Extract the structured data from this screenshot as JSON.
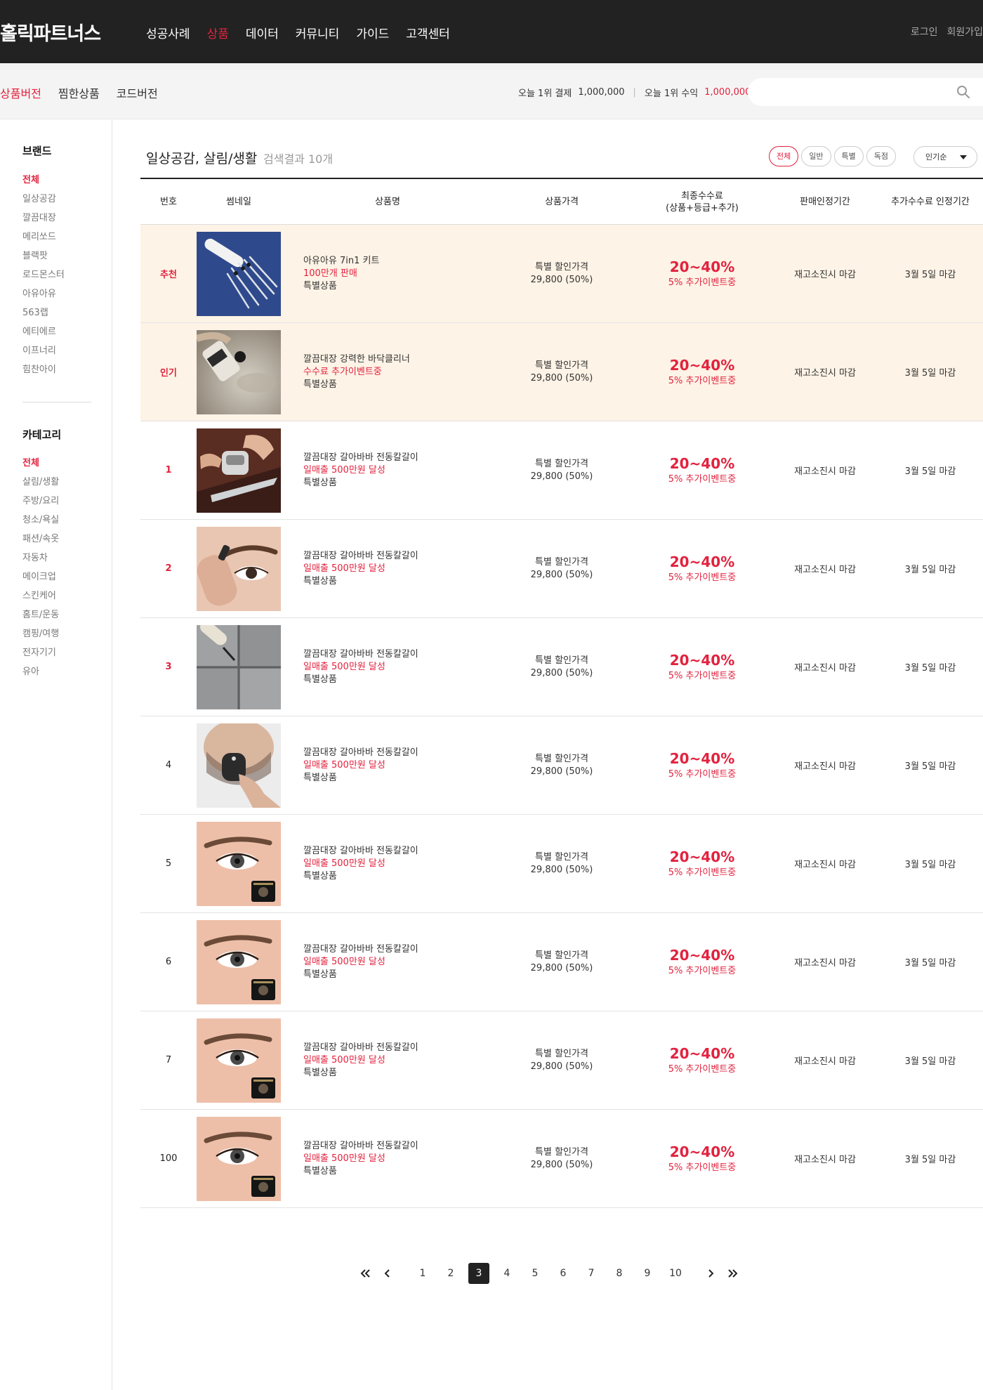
{
  "header": {
    "logo": "홀릭파트너스",
    "nav": [
      "성공사례",
      "상품",
      "데이터",
      "커뮤니티",
      "가이드",
      "고객센터"
    ],
    "nav_active": 1,
    "login": "로그인",
    "signup": "회원가입"
  },
  "subnav": {
    "tabs": [
      "상품버전",
      "찜한상품",
      "코드버전"
    ],
    "active": 0,
    "stat1_label": "오늘 1위 결제",
    "stat1_value": "1,000,000",
    "stat_sep": "|",
    "stat2_label": "오늘 1위 수익",
    "stat2_value": "1,000,000",
    "search_placeholder": ""
  },
  "sidebar": {
    "brand_title": "브랜드",
    "brands": [
      "전체",
      "일상공감",
      "깔끔대장",
      "메리쏘드",
      "블랙팟",
      "로드몬스터",
      "아유아유",
      "563랩",
      "에티에르",
      "이프너리",
      "힘찬아이"
    ],
    "category_title": "카테고리",
    "categories": [
      "전체",
      "살림/생활",
      "주방/요리",
      "청소/욕실",
      "패션/속옷",
      "자동차",
      "메이크업",
      "스킨케어",
      "홈트/운동",
      "캠핑/여행",
      "전자기기",
      "유아"
    ]
  },
  "main": {
    "title": "일상공감, 살림/생활",
    "result_count": "검색결과 10개",
    "filters": [
      "전체",
      "일반",
      "특별",
      "독점"
    ],
    "filter_active": 0,
    "sort": "인기순"
  },
  "table": {
    "headers": {
      "no": "번호",
      "thumb": "썸네일",
      "name": "상품명",
      "price": "상품가격",
      "comm_l1": "최종수수료",
      "comm_l2": "(상품+등급+추가)",
      "period": "판매인정기간",
      "add_period": "추가수수료 인정기간"
    },
    "rows": [
      {
        "no": "추천",
        "highlight": true,
        "thumb": "tweezers",
        "name": "아유아유 7in1 키트",
        "sub": "100만개 판매",
        "tag": "특별상품",
        "price_label": "특별 할인가격",
        "price": "29,800 (50%)",
        "commission": "20~40%",
        "event": "5% 추가이벤트중",
        "period": "재고소진시 마감",
        "add_period": "3월 5일 마감"
      },
      {
        "no": "인기",
        "highlight": true,
        "thumb": "cleaner",
        "name": "깔끔대장 강력한 바닥클리너",
        "sub": "수수료 추가이벤트중",
        "tag": "특별상품",
        "price_label": "특별 할인가격",
        "price": "29,800 (50%)",
        "commission": "20~40%",
        "event": "5% 추가이벤트중",
        "period": "재고소진시 마감",
        "add_period": "3월 5일 마감"
      },
      {
        "no": "1",
        "highlight": false,
        "thumb": "sharpener",
        "name": "깔끔대장 갈아바바 전동칼갈이",
        "sub": "일매출 500만원 달성",
        "tag": "특별상품",
        "price_label": "특별 할인가격",
        "price": "29,800 (50%)",
        "commission": "20~40%",
        "event": "5% 추가이벤트중",
        "period": "재고소진시 마감",
        "add_period": "3월 5일 마감"
      },
      {
        "no": "2",
        "highlight": false,
        "thumb": "brow",
        "name": "깔끔대장 갈아바바 전동칼갈이",
        "sub": "일매출 500만원 달성",
        "tag": "특별상품",
        "price_label": "특별 할인가격",
        "price": "29,800 (50%)",
        "commission": "20~40%",
        "event": "5% 추가이벤트중",
        "period": "재고소진시 마감",
        "add_period": "3월 5일 마감"
      },
      {
        "no": "3",
        "highlight": false,
        "thumb": "tile",
        "name": "깔끔대장 갈아바바 전동칼갈이",
        "sub": "일매출 500만원 달성",
        "tag": "특별상품",
        "price_label": "특별 할인가격",
        "price": "29,800 (50%)",
        "commission": "20~40%",
        "event": "5% 추가이벤트중",
        "period": "재고소진시 마감",
        "add_period": "3월 5일 마감"
      },
      {
        "no": "4",
        "highlight": false,
        "thumb": "shaver",
        "name": "깔끔대장 갈아바바 전동칼갈이",
        "sub": "일매출 500만원 달성",
        "tag": "특별상품",
        "price_label": "특별 할인가격",
        "price": "29,800 (50%)",
        "commission": "20~40%",
        "event": "5% 추가이벤트중",
        "period": "재고소진시 마감",
        "add_period": "3월 5일 마감"
      },
      {
        "no": "5",
        "highlight": false,
        "thumb": "eye",
        "name": "깔끔대장 갈아바바 전동칼갈이",
        "sub": "일매출 500만원 달성",
        "tag": "특별상품",
        "price_label": "특별 할인가격",
        "price": "29,800 (50%)",
        "commission": "20~40%",
        "event": "5% 추가이벤트중",
        "period": "재고소진시 마감",
        "add_period": "3월 5일 마감"
      },
      {
        "no": "6",
        "highlight": false,
        "thumb": "eye",
        "name": "깔끔대장 갈아바바 전동칼갈이",
        "sub": "일매출 500만원 달성",
        "tag": "특별상품",
        "price_label": "특별 할인가격",
        "price": "29,800 (50%)",
        "commission": "20~40%",
        "event": "5% 추가이벤트중",
        "period": "재고소진시 마감",
        "add_period": "3월 5일 마감"
      },
      {
        "no": "7",
        "highlight": false,
        "thumb": "eye",
        "name": "깔끔대장 갈아바바 전동칼갈이",
        "sub": "일매출 500만원 달성",
        "tag": "특별상품",
        "price_label": "특별 할인가격",
        "price": "29,800 (50%)",
        "commission": "20~40%",
        "event": "5% 추가이벤트중",
        "period": "재고소진시 마감",
        "add_period": "3월 5일 마감"
      },
      {
        "no": "100",
        "highlight": false,
        "thumb": "eye",
        "name": "깔끔대장 갈아바바 전동칼갈이",
        "sub": "일매출 500만원 달성",
        "tag": "특별상품",
        "price_label": "특별 할인가격",
        "price": "29,800 (50%)",
        "commission": "20~40%",
        "event": "5% 추가이벤트중",
        "period": "재고소진시 마감",
        "add_period": "3월 5일 마감"
      }
    ]
  },
  "pagination": {
    "pages": [
      "1",
      "2",
      "3",
      "4",
      "5",
      "6",
      "7",
      "8",
      "9",
      "10"
    ],
    "current": "3"
  },
  "colors": {
    "accent": "#e2223e",
    "header_bg": "#222222",
    "highlight_row": "#fdf3e6"
  }
}
